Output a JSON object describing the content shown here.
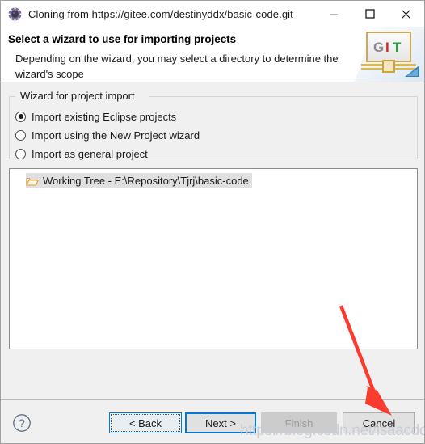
{
  "window": {
    "title": "Cloning from https://gitee.com/destinyddx/basic-code.git",
    "icon": "git-clone-icon",
    "controls": {
      "minimize": "minimize-icon",
      "maximize": "maximize-icon",
      "close": "close-icon"
    }
  },
  "header": {
    "title": "Select a wizard to use for importing projects",
    "description": "Depending on the wizard, you may select a directory to determine the wizard's scope",
    "logo": {
      "letters": [
        "G",
        "I",
        "T"
      ],
      "colors": {
        "g": "#8c8c8c",
        "i": "#cc2a2a",
        "t": "#2f9e46",
        "band": "#d9b84c",
        "triangle": "#2f7fbf"
      }
    }
  },
  "group": {
    "legend": "Wizard for project import",
    "options": [
      {
        "label": "Import existing Eclipse projects",
        "selected": true
      },
      {
        "label": "Import using the New Project wizard",
        "selected": false
      },
      {
        "label": "Import as general project",
        "selected": false
      }
    ]
  },
  "tree": {
    "items": [
      {
        "label": "Working Tree - E:\\Repository\\Tjrj\\basic-code",
        "icon": "open-folder-icon",
        "selected": true
      }
    ]
  },
  "buttons": {
    "help": "?",
    "back": "< Back",
    "next": "Next >",
    "finish": "Finish",
    "cancel": "Cancel"
  },
  "annotation": {
    "arrow_color": "#fb3b30",
    "points_to": "cancel-button"
  },
  "watermark": {
    "text": "https://blog.csdn.net/isaacddx"
  }
}
